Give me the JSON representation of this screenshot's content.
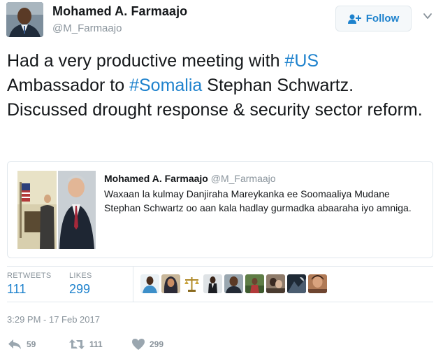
{
  "author": {
    "name": "Mohamed A. Farmaajo",
    "handle": "@M_Farmaajo"
  },
  "follow_button": {
    "label": "Follow",
    "icon": "add-user-icon"
  },
  "tweet": {
    "parts": [
      "Had a very productive meeting with ",
      "#US",
      " Ambassador to ",
      "#Somalia",
      " Stephan Schwartz. Discussed drought response & security sector reform."
    ]
  },
  "quoted_tweet": {
    "author_name": "Mohamed A. Farmaajo",
    "author_handle": "@M_Farmaajo",
    "text": "Waxaan la kulmay Danjiraha Mareykanka ee Soomaaliya Mudane Stephan Schwartz oo aan kala hadlay gurmadka abaaraha iyo amniga."
  },
  "stats": {
    "retweets_label": "RETWEETS",
    "retweets": "111",
    "likes_label": "LIKES",
    "likes": "299",
    "liker_count_shown": 9
  },
  "timestamp": "3:29 PM - 17 Feb 2017",
  "actions": {
    "reply_count": "59",
    "retweet_count": "111",
    "like_count": "299"
  },
  "colors": {
    "link": "#1e82cd",
    "muted": "#8a949c",
    "border": "#e1e8ed",
    "text": "#14171a"
  }
}
